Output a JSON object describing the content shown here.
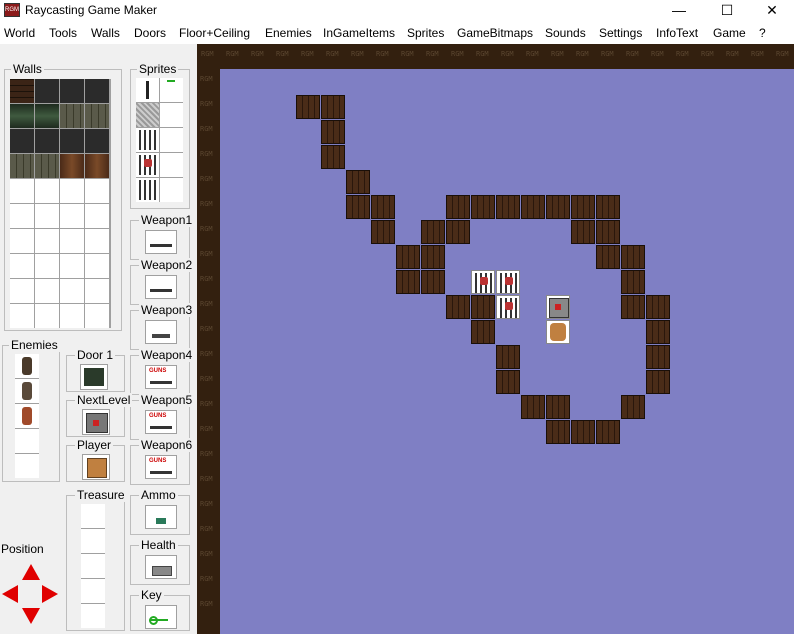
{
  "titlebar": {
    "title": "Raycasting Game Maker",
    "icon_text": "RGM",
    "minimize": "—",
    "maximize": "☐",
    "close": "✕"
  },
  "menu": [
    "World",
    "Tools",
    "Walls",
    "Doors",
    "Floor+Ceiling",
    "Enemies",
    "InGameItems",
    "Sprites",
    "GameBitmaps",
    "Sounds",
    "Settings",
    "InfoText",
    "Game",
    "?"
  ],
  "panel": {
    "walls_label": "Walls",
    "sprites_label": "Sprites",
    "enemies_label": "Enemies",
    "door_label": "Door 1",
    "nextlevel_label": "NextLevel",
    "player_label": "Player",
    "treasure_label": "Treasure",
    "position_label": "Position",
    "weapons": [
      "Weapon1",
      "Weapon2",
      "Weapon3",
      "Weapon4",
      "Weapon5",
      "Weapon6"
    ],
    "ammo_label": "Ammo",
    "health_label": "Health",
    "key_label": "Key",
    "guns_text": "GUNS"
  },
  "map": {
    "border_text": "RGM"
  }
}
